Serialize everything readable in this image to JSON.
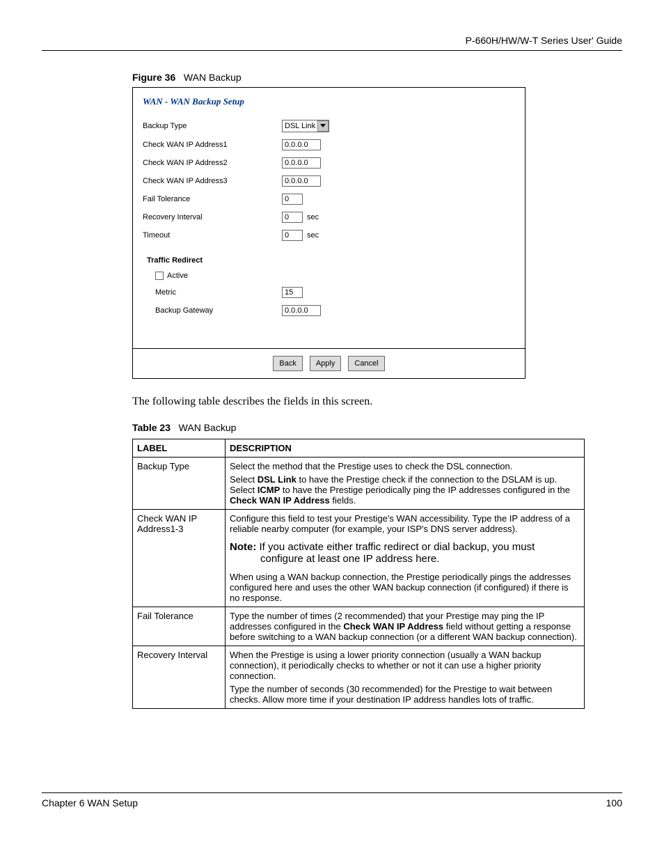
{
  "header": {
    "guide": "P-660H/HW/W-T Series User' Guide"
  },
  "figure": {
    "label": "Figure 36",
    "title": "WAN Backup"
  },
  "screenshot": {
    "title": "WAN - WAN Backup Setup",
    "backup_type_label": "Backup Type",
    "backup_type_value": "DSL Link",
    "ip1_label": "Check WAN IP Address1",
    "ip1_value": "0.0.0.0",
    "ip2_label": "Check WAN IP Address2",
    "ip2_value": "0.0.0.0",
    "ip3_label": "Check WAN IP Address3",
    "ip3_value": "0.0.0.0",
    "fail_label": "Fail Tolerance",
    "fail_value": "0",
    "recovery_label": "Recovery Interval",
    "recovery_value": "0",
    "timeout_label": "Timeout",
    "timeout_value": "0",
    "unit_sec": "sec",
    "traffic_redirect": "Traffic Redirect",
    "active_label": "Active",
    "metric_label": "Metric",
    "metric_value": "15",
    "gateway_label": "Backup Gateway",
    "gateway_value": "0.0.0.0",
    "btn_back": "Back",
    "btn_apply": "Apply",
    "btn_cancel": "Cancel"
  },
  "body_text": "The following table describes the fields in this screen.",
  "table_caption": {
    "label": "Table 23",
    "title": "WAN Backup"
  },
  "table": {
    "h_label": "LABEL",
    "h_desc": "DESCRIPTION",
    "r1_label": "Backup Type",
    "r1_p1": "Select the method that the Prestige uses to check the DSL connection.",
    "r1_p2a": "Select ",
    "r1_p2b": "DSL Link",
    "r1_p2c": " to have the Prestige check if the connection to the DSLAM is up. Select ",
    "r1_p2d": "ICMP",
    "r1_p2e": " to have the Prestige periodically ping the IP addresses configured in the ",
    "r1_p2f": "Check WAN IP Address",
    "r1_p2g": " fields.",
    "r2_label": "Check WAN IP Address1-3",
    "r2_p1": "Configure this field to test your Prestige's WAN accessibility. Type the IP address of a reliable nearby computer (for example, your ISP's DNS server address).",
    "r2_note_b": "Note:",
    "r2_note_1": " If you activate either traffic redirect or dial backup, you must",
    "r2_note_2": "configure at least one IP address here.",
    "r2_p2": "When using a WAN backup connection, the Prestige periodically pings the addresses configured here and uses the other WAN backup connection (if configured) if there is no response.",
    "r3_label": "Fail Tolerance",
    "r3_p1a": "Type the number of times (2 recommended) that your Prestige may ping the IP addresses configured in the ",
    "r3_p1b": "Check WAN IP Address",
    "r3_p1c": " field without getting a response before switching to a WAN backup connection (or a different WAN backup connection).",
    "r4_label": "Recovery Interval",
    "r4_p1": "When the Prestige is using a lower priority connection (usually a WAN backup connection), it periodically checks to whether or not it can use a higher priority connection.",
    "r4_p2": "Type the number of seconds (30 recommended) for the Prestige to wait between checks. Allow more time if your destination IP address handles lots of traffic."
  },
  "footer": {
    "chapter": "Chapter 6 WAN Setup",
    "page": "100"
  }
}
